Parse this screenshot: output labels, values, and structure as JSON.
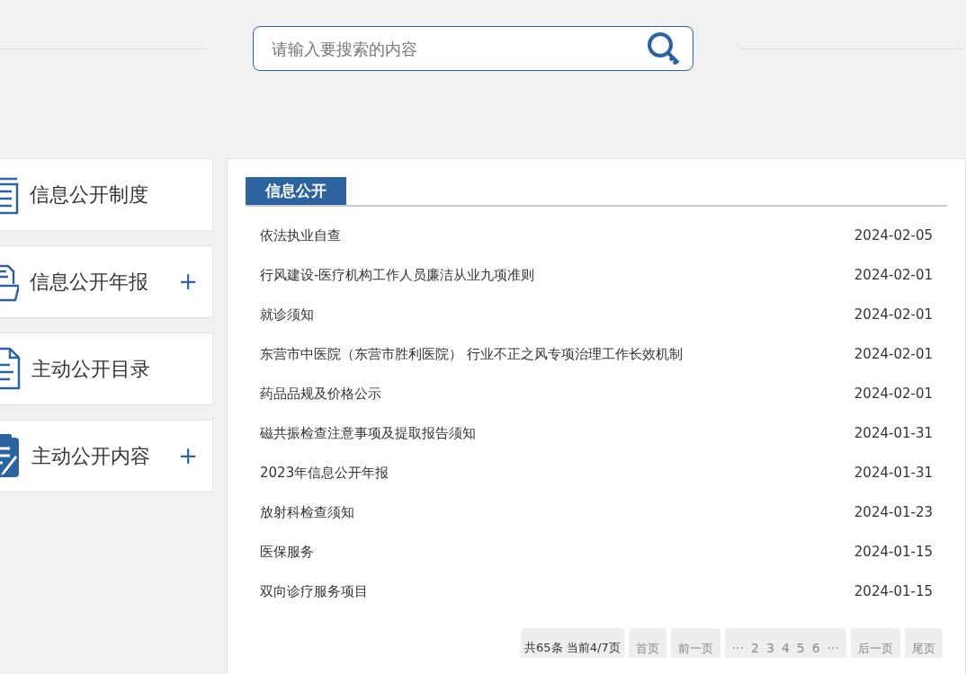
{
  "search": {
    "placeholder": "请输入要搜索的内容"
  },
  "sidebar": {
    "items": [
      {
        "label": "信息公开制度",
        "kind": "list"
      },
      {
        "label": "信息公开年报",
        "kind": "folder",
        "expander": "+"
      },
      {
        "label": "主动公开目录",
        "kind": "document"
      },
      {
        "label": "主动公开内容",
        "kind": "clipboard",
        "expander": "+"
      }
    ]
  },
  "panel": {
    "title": "信息公开",
    "rows": [
      {
        "title": "依法执业自查",
        "date": "2024-02-05"
      },
      {
        "title": "行风建设-医疗机构工作人员廉洁从业九项准则",
        "date": "2024-02-01"
      },
      {
        "title": "就诊须知",
        "date": "2024-02-01"
      },
      {
        "title": "东营市中医院（东营市胜利医院） 行业不正之风专项治理工作长效机制",
        "date": "2024-02-01"
      },
      {
        "title": "药品品规及价格公示",
        "date": "2024-02-01"
      },
      {
        "title": "磁共振检查注意事项及提取报告须知",
        "date": "2024-01-31"
      },
      {
        "title": "2023年信息公开年报",
        "date": "2024-01-31"
      },
      {
        "title": "放射科检查须知",
        "date": "2024-01-23"
      },
      {
        "title": "医保服务",
        "date": "2024-01-15"
      },
      {
        "title": "双向诊疗服务项目",
        "date": "2024-01-15"
      }
    ],
    "pagination": {
      "summary": "共65条 当前4/7页",
      "first": "首页",
      "prev": "前一页",
      "pages": [
        "···",
        "2",
        "3",
        "4",
        "5",
        "6",
        "···"
      ],
      "next": "后一页",
      "last": "尾页"
    }
  }
}
